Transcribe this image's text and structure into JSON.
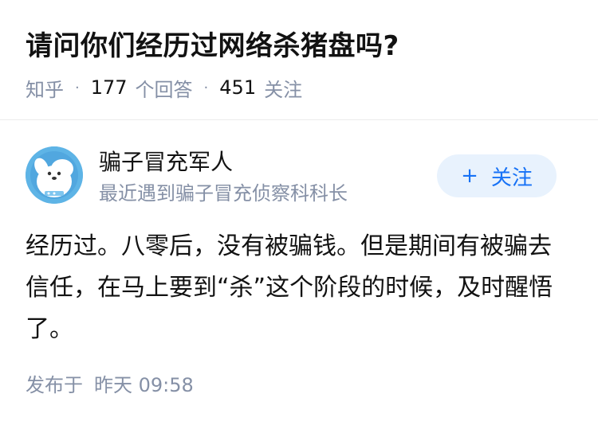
{
  "question": {
    "title": "请问你们经历过网络杀猪盘吗?",
    "source": "知乎",
    "answer_count": "177",
    "answer_label": "个回答",
    "follow_count": "451",
    "follow_label": "关注"
  },
  "author": {
    "avatar_icon": "cartoon-dog-avatar",
    "name": "骗子冒充军人",
    "bio": "最近遇到骗子冒充侦察科科长",
    "follow_button_label": "关注",
    "follow_button_icon": "plus-icon"
  },
  "answer": {
    "content": "经历过。八零后，没有被骗钱。但是期间有被骗去信任，在马上要到“杀”这个阶段的时候，及时醒悟了。",
    "published_label": "发布于",
    "published_time": "昨天 09:58"
  },
  "colors": {
    "accent": "#1772f6",
    "muted": "#8590a6",
    "follow_bg": "#e8f2fd"
  }
}
